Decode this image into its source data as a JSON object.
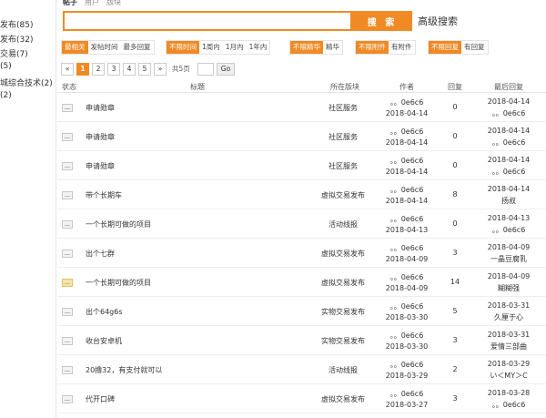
{
  "sidebar": {
    "items": [
      {
        "label": "发布(85)"
      },
      {
        "label": "发布(32)"
      },
      {
        "label": "交易(7)"
      },
      {
        "label": "(5)"
      },
      {
        "label": "城综合技术(2)"
      },
      {
        "label": "(2)"
      }
    ]
  },
  "top_tabs": {
    "posts": "帖子",
    "users": "用户",
    "boards": "版块"
  },
  "search": {
    "value": "",
    "button_label": "搜 索",
    "advanced_label": "高级搜索"
  },
  "filters": {
    "sort": [
      {
        "label": "最相关",
        "active": true
      },
      {
        "label": "发帖时间",
        "active": false
      },
      {
        "label": "最多回复",
        "active": false
      }
    ],
    "time": [
      {
        "label": "不限时间",
        "active": true
      },
      {
        "label": "1周内",
        "active": false
      },
      {
        "label": "1月内",
        "active": false
      },
      {
        "label": "1年内",
        "active": false
      }
    ],
    "digest": [
      {
        "label": "不限精华",
        "active": true
      },
      {
        "label": "精华",
        "active": false
      }
    ],
    "attach": [
      {
        "label": "不限附件",
        "active": true
      },
      {
        "label": "有附件",
        "active": false
      }
    ],
    "reply": [
      {
        "label": "不限回复",
        "active": true
      },
      {
        "label": "有回复",
        "active": false
      }
    ]
  },
  "pager": {
    "prev": "«",
    "pages": [
      "1",
      "2",
      "3",
      "4",
      "5"
    ],
    "current": "1",
    "next": "»",
    "total": "共5页",
    "go": "Go"
  },
  "table": {
    "columns": {
      "status": "状态",
      "title": "标题",
      "board": "所在版块",
      "author": "作者",
      "replies": "回复",
      "last": "最后回复"
    },
    "rows": [
      {
        "title": "申请勋章",
        "board": "社区服务",
        "author": "。。0e6c6",
        "date": "2018-04-14",
        "replies": "0",
        "last_date": "2018-04-14",
        "last_user": "。。0e6c6",
        "hot": false
      },
      {
        "title": "申请勋章",
        "board": "社区服务",
        "author": "。。0e6c6",
        "date": "2018-04-14",
        "replies": "0",
        "last_date": "2018-04-14",
        "last_user": "。。0e6c6",
        "hot": false
      },
      {
        "title": "申请勋章",
        "board": "社区服务",
        "author": "。。0e6c6",
        "date": "2018-04-14",
        "replies": "0",
        "last_date": "2018-04-14",
        "last_user": "。。0e6c6",
        "hot": false
      },
      {
        "title": "带个长期车",
        "board": "虚拟交易发布",
        "author": "。。0e6c6",
        "date": "2018-04-14",
        "replies": "8",
        "last_date": "2018-04-14",
        "last_user": "扬叔",
        "hot": false
      },
      {
        "title": "一个长期可做的项目",
        "board": "活动线报",
        "author": "。。0e6c6",
        "date": "2018-04-13",
        "replies": "0",
        "last_date": "2018-04-13",
        "last_user": "。。0e6c6",
        "hot": false
      },
      {
        "title": "出个七群",
        "board": "虚拟交易发布",
        "author": "。。0e6c6",
        "date": "2018-04-09",
        "replies": "3",
        "last_date": "2018-04-09",
        "last_user": "一晶豆腐乳",
        "hot": false
      },
      {
        "title": "一个长期可做的项目",
        "board": "虚拟交易发布",
        "author": "。。0e6c6",
        "date": "2018-04-09",
        "replies": "14",
        "last_date": "2018-04-09",
        "last_user": "糊糊强",
        "hot": true
      },
      {
        "title": "出个64g6s",
        "board": "实物交易发布",
        "author": "。。0e6c6",
        "date": "2018-03-30",
        "replies": "5",
        "last_date": "2018-03-31",
        "last_user": "久厘于心",
        "hot": false
      },
      {
        "title": "收台安卓机",
        "board": "实物交易发布",
        "author": "。。0e6c6",
        "date": "2018-03-30",
        "replies": "3",
        "last_date": "2018-03-31",
        "last_user": "爱情三部曲",
        "hot": false
      },
      {
        "title": "20撸32，有支付就可以",
        "board": "活动线报",
        "author": "。。0e6c6",
        "date": "2018-03-29",
        "replies": "2",
        "last_date": "2018-03-29",
        "last_user": "い＜MY＞C",
        "hot": false
      },
      {
        "title": "代开口碑",
        "board": "虚拟交易发布",
        "author": "。。0e6c6",
        "date": "2018-03-27",
        "replies": "3",
        "last_date": "2018-03-28",
        "last_user": "。。0e6c6",
        "hot": false
      }
    ]
  },
  "colors": {
    "accent": "#f08a24"
  }
}
